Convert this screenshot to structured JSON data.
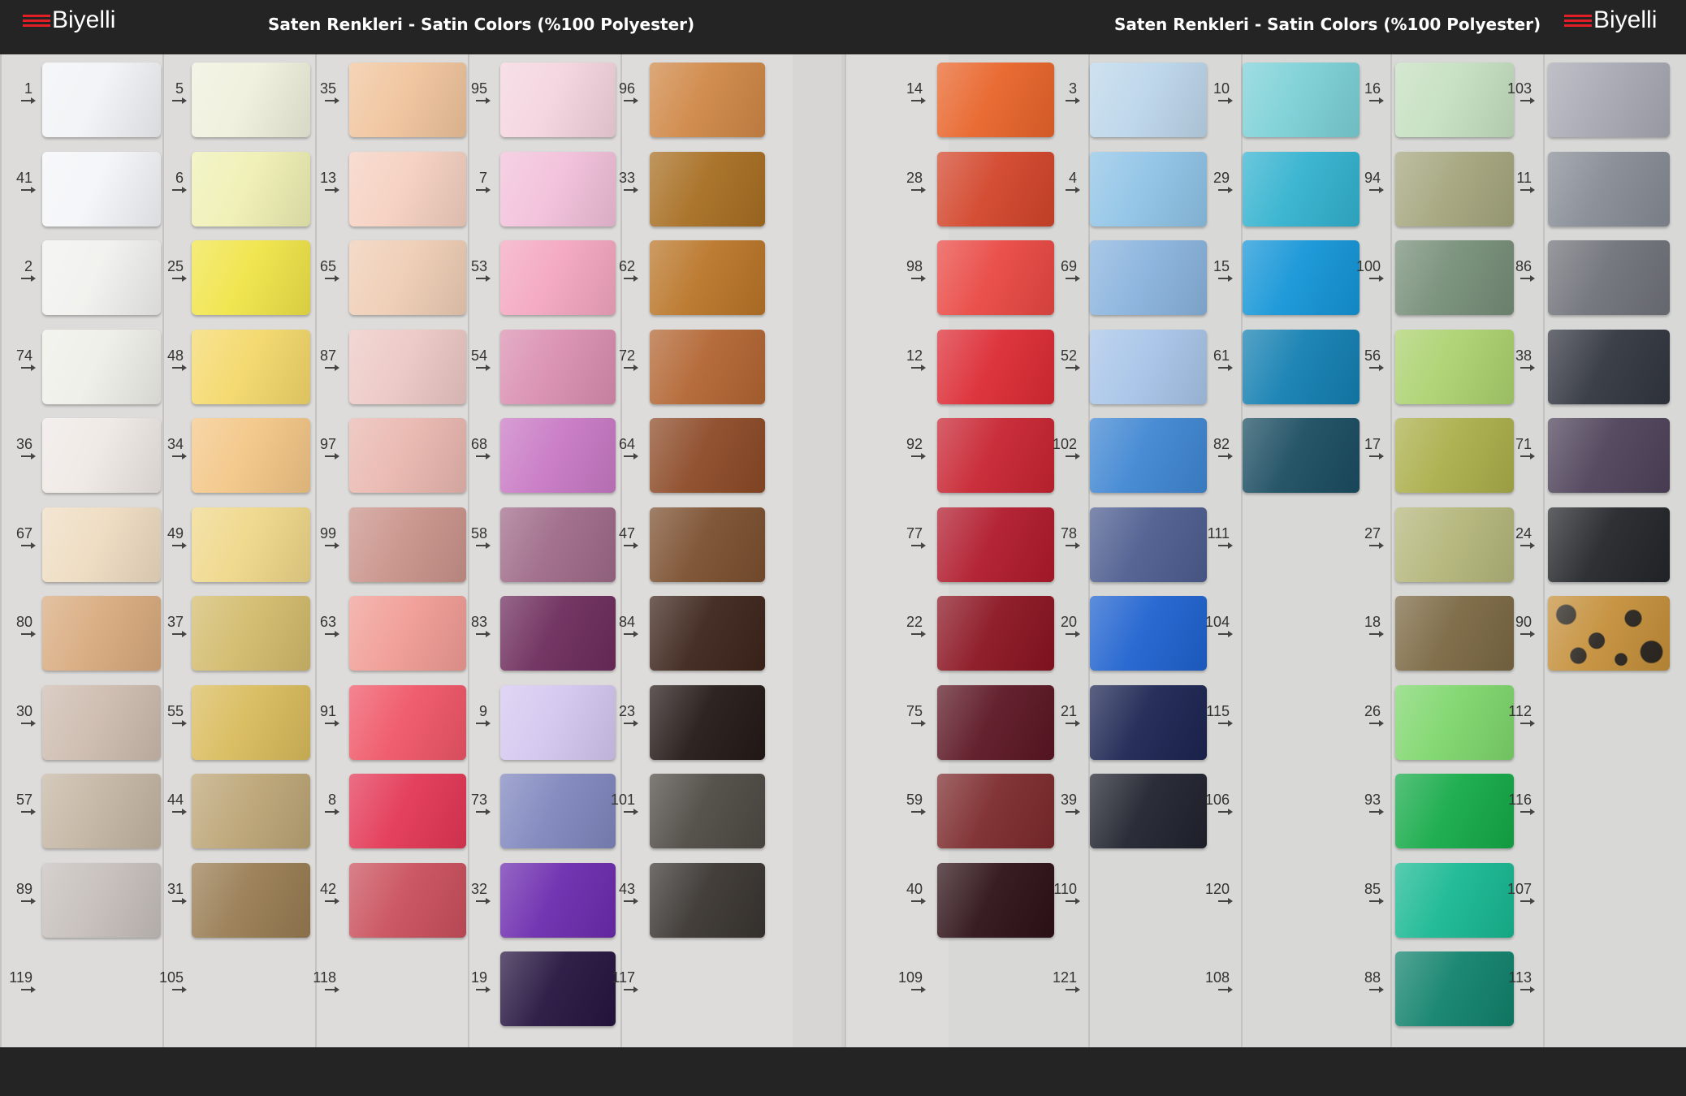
{
  "header": {
    "logo_left": "Biyelli",
    "logo_right": "Biyelli",
    "title_left": "Saten Renkleri - Satin Colors (%100 Polyester)",
    "title_right": "Saten Renkleri - Satin Colors (%100 Polyester)"
  },
  "brand_color": "#e21f26",
  "left_panel": {
    "columns": [
      {
        "swatches": [
          {
            "code": "1",
            "color": "#f2f3f6"
          },
          {
            "code": "41",
            "color": "#f4f5f8"
          },
          {
            "code": "2",
            "color": "#f1f1ee"
          },
          {
            "code": "74",
            "color": "#efefe9"
          },
          {
            "code": "36",
            "color": "#efe9e5"
          },
          {
            "code": "67",
            "color": "#eedcc1"
          },
          {
            "code": "80",
            "color": "#d8aa7e"
          },
          {
            "code": "30",
            "color": "#cdbbae"
          },
          {
            "code": "57",
            "color": "#c4b5a2"
          },
          {
            "code": "89",
            "color": "#c6bfbb"
          },
          {
            "code": "119",
            "color": ""
          }
        ]
      },
      {
        "swatches": [
          {
            "code": "5",
            "color": "#f0f0dd"
          },
          {
            "code": "6",
            "color": "#eff0b4"
          },
          {
            "code": "25",
            "color": "#f0e448"
          },
          {
            "code": "48",
            "color": "#f4d86a"
          },
          {
            "code": "34",
            "color": "#f3c686"
          },
          {
            "code": "49",
            "color": "#efd789"
          },
          {
            "code": "37",
            "color": "#d2bb6c"
          },
          {
            "code": "55",
            "color": "#d9bb5c"
          },
          {
            "code": "44",
            "color": "#bca576"
          },
          {
            "code": "31",
            "color": "#987c52"
          },
          {
            "code": "105",
            "color": ""
          }
        ]
      },
      {
        "swatches": [
          {
            "code": "35",
            "color": "#f0c49c"
          },
          {
            "code": "13",
            "color": "#f5d0c0"
          },
          {
            "code": "65",
            "color": "#efcdb4"
          },
          {
            "code": "87",
            "color": "#ecc8c4"
          },
          {
            "code": "97",
            "color": "#e9b7af"
          },
          {
            "code": "99",
            "color": "#c9938a"
          },
          {
            "code": "63",
            "color": "#f09c94"
          },
          {
            "code": "91",
            "color": "#ef5667"
          },
          {
            "code": "8",
            "color": "#e33755"
          },
          {
            "code": "42",
            "color": "#c9505c"
          },
          {
            "code": "118",
            "color": ""
          }
        ]
      },
      {
        "swatches": [
          {
            "code": "95",
            "color": "#f4d4df"
          },
          {
            "code": "7",
            "color": "#f2c0da"
          },
          {
            "code": "53",
            "color": "#f3a6c0"
          },
          {
            "code": "54",
            "color": "#d98eb0"
          },
          {
            "code": "68",
            "color": "#c879c4"
          },
          {
            "code": "58",
            "color": "#9e6a88"
          },
          {
            "code": "83",
            "color": "#6d2c5c"
          },
          {
            "code": "9",
            "color": "#d4c6ef"
          },
          {
            "code": "73",
            "color": "#7f86bd"
          },
          {
            "code": "32",
            "color": "#6c2bae"
          },
          {
            "code": "19",
            "color": "#261540"
          }
        ]
      },
      {
        "swatches": [
          {
            "code": "96",
            "color": "#cf8746"
          },
          {
            "code": "33",
            "color": "#a76e22"
          },
          {
            "code": "62",
            "color": "#b97528"
          },
          {
            "code": "72",
            "color": "#b26532"
          },
          {
            "code": "64",
            "color": "#8c4a27"
          },
          {
            "code": "47",
            "color": "#7b4f2f"
          },
          {
            "code": "84",
            "color": "#3d251b"
          },
          {
            "code": "23",
            "color": "#241917"
          },
          {
            "code": "101",
            "color": "#4e4a44"
          },
          {
            "code": "43",
            "color": "#3a3531"
          },
          {
            "code": "117",
            "color": ""
          }
        ]
      }
    ]
  },
  "right_panel": {
    "columns": [
      {
        "swatches": [
          {
            "code": "14",
            "color": "#e8642a"
          },
          {
            "code": "28",
            "color": "#d2452a"
          },
          {
            "code": "98",
            "color": "#e94843"
          },
          {
            "code": "12",
            "color": "#dc2b34"
          },
          {
            "code": "92",
            "color": "#c72431"
          },
          {
            "code": "77",
            "color": "#b01a2c"
          },
          {
            "code": "22",
            "color": "#8a1421"
          },
          {
            "code": "75",
            "color": "#5b1623"
          },
          {
            "code": "59",
            "color": "#7c2a2c"
          },
          {
            "code": "40",
            "color": "#2e1217"
          },
          {
            "code": "109",
            "color": ""
          }
        ]
      },
      {
        "swatches": [
          {
            "code": "3",
            "color": "#bcd6ea"
          },
          {
            "code": "4",
            "color": "#8fc3e6"
          },
          {
            "code": "69",
            "color": "#89b3dd"
          },
          {
            "code": "52",
            "color": "#a7c4e8"
          },
          {
            "code": "102",
            "color": "#3f86d2"
          },
          {
            "code": "78",
            "color": "#4d5d8f"
          },
          {
            "code": "20",
            "color": "#1f62cf"
          },
          {
            "code": "21",
            "color": "#1c2552"
          },
          {
            "code": "39",
            "color": "#20232e"
          },
          {
            "code": "110",
            "color": ""
          },
          {
            "code": "121",
            "color": ""
          }
        ]
      },
      {
        "swatches": [
          {
            "code": "10",
            "color": "#7bd0d6"
          },
          {
            "code": "29",
            "color": "#33b2cf"
          },
          {
            "code": "15",
            "color": "#1495d7"
          },
          {
            "code": "61",
            "color": "#137fb1"
          },
          {
            "code": "82",
            "color": "#1b4d61"
          },
          {
            "code": "111",
            "color": ""
          },
          {
            "code": "104",
            "color": ""
          },
          {
            "code": "115",
            "color": ""
          },
          {
            "code": "106",
            "color": ""
          },
          {
            "code": "120",
            "color": ""
          },
          {
            "code": "108",
            "color": ""
          }
        ]
      },
      {
        "swatches": [
          {
            "code": "16",
            "color": "#c5dfc0"
          },
          {
            "code": "94",
            "color": "#a5a67e"
          },
          {
            "code": "100",
            "color": "#768e78"
          },
          {
            "code": "56",
            "color": "#abd16e"
          },
          {
            "code": "17",
            "color": "#abae4a"
          },
          {
            "code": "27",
            "color": "#b4b67b"
          },
          {
            "code": "18",
            "color": "#7b6843"
          },
          {
            "code": "26",
            "color": "#7ed66c"
          },
          {
            "code": "93",
            "color": "#15aa48"
          },
          {
            "code": "85",
            "color": "#18b892"
          },
          {
            "code": "88",
            "color": "#11826c"
          }
        ]
      },
      {
        "swatches": [
          {
            "code": "103",
            "color": "#a7a8b2"
          },
          {
            "code": "11",
            "color": "#868b94"
          },
          {
            "code": "86",
            "color": "#6f7279"
          },
          {
            "code": "38",
            "color": "#323640"
          },
          {
            "code": "71",
            "color": "#4e4259"
          },
          {
            "code": "24",
            "color": "#23262a"
          },
          {
            "code": "90",
            "color": "leopard"
          },
          {
            "code": "112",
            "color": ""
          },
          {
            "code": "116",
            "color": ""
          },
          {
            "code": "107",
            "color": ""
          },
          {
            "code": "113",
            "color": ""
          }
        ]
      }
    ]
  }
}
